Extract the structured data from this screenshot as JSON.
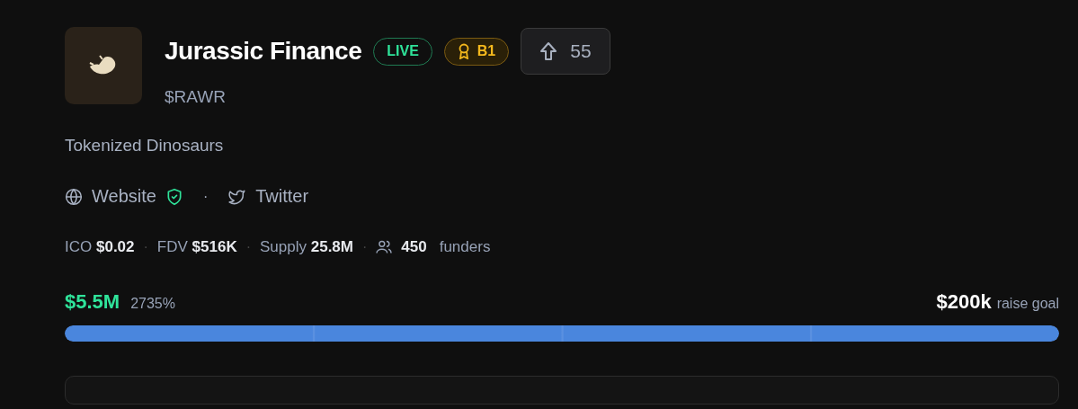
{
  "project": {
    "name": "Jurassic Finance",
    "ticker": "$RAWR",
    "description": "Tokenized Dinosaurs"
  },
  "badges": [
    {
      "kind": "status",
      "label": "LIVE"
    },
    {
      "kind": "award",
      "label": "B1"
    }
  ],
  "upvote": {
    "count": "55"
  },
  "links": [
    {
      "kind": "website",
      "label": "Website",
      "verified": true
    },
    {
      "kind": "twitter",
      "label": "Twitter"
    }
  ],
  "links_separator": "·",
  "stats": [
    {
      "kind": "metric",
      "label": "ICO",
      "value": "$0.02"
    },
    {
      "kind": "metric",
      "label": "FDV",
      "value": "$516K"
    },
    {
      "kind": "metric",
      "label": "Supply",
      "value": "25.8M"
    },
    {
      "kind": "people",
      "value": "450",
      "label": "funders"
    }
  ],
  "stats_separator": "·",
  "raise": {
    "raised": "$5.5M",
    "percent": "2735%",
    "goal": "$200k",
    "goal_label": "raise goal",
    "level": 1
  }
}
